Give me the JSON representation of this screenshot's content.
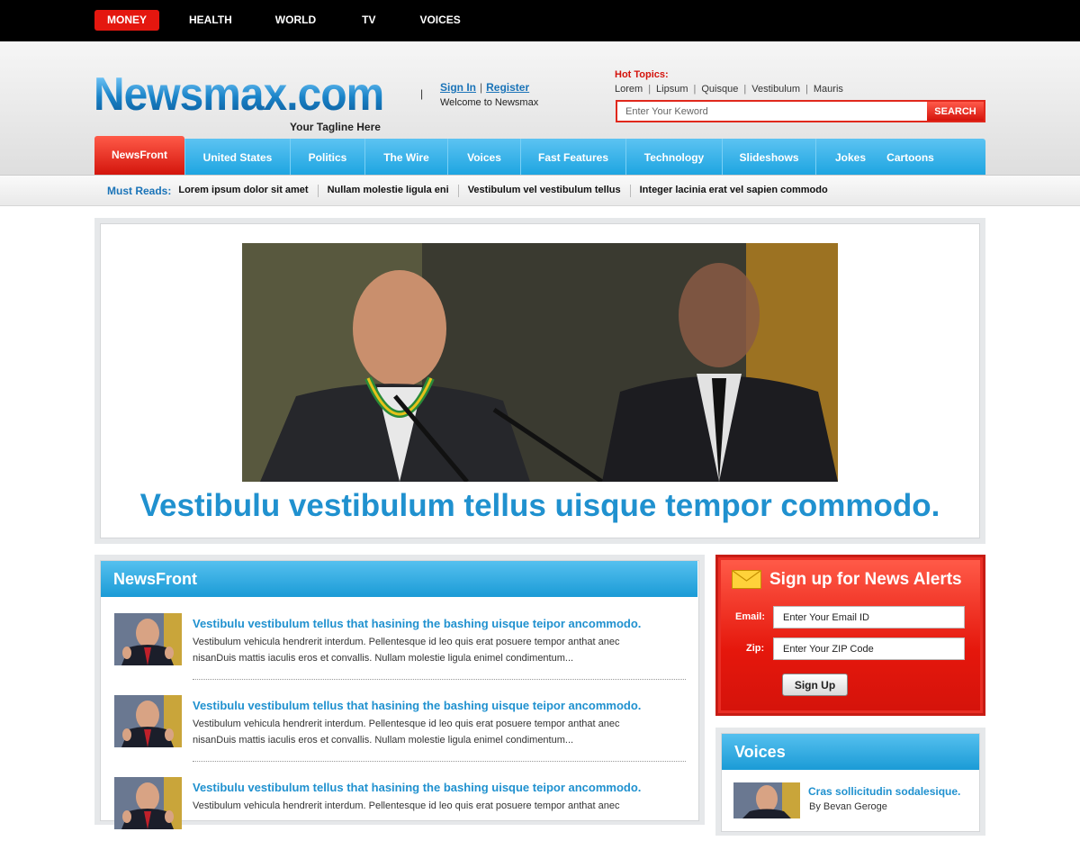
{
  "top_nav": [
    "MONEY",
    "HEALTH",
    "WORLD",
    "TV",
    "VOICES"
  ],
  "header": {
    "logo": "Newsmax.com",
    "tagline": "Your Tagline Here",
    "separator": "|",
    "sign_in": "Sign In",
    "register": "Register",
    "auth_sep": "|",
    "welcome": "Welcome to Newsmax",
    "hot_topics_label": "Hot Topics:",
    "hot_topics": [
      "Lorem",
      "Lipsum",
      "Quisque",
      "Vestibulum",
      "Mauris"
    ],
    "search_placeholder": "Enter Your Keword",
    "search_button": "SEARCH"
  },
  "main_nav": [
    "NewsFront",
    "United States",
    "Politics",
    "The Wire",
    "Voices",
    "Fast Features",
    "Technology",
    "Slideshows",
    "Jokes",
    "Cartoons"
  ],
  "must_reads": {
    "label": "Must Reads:",
    "links": [
      "Lorem ipsum dolor sit amet",
      "Nullam molestie ligula eni",
      "Vestibulum vel vestibulum tellus",
      "Integer lacinia erat vel sapien commodo"
    ]
  },
  "hero": {
    "title": "Vestibulu vestibulum tellus uisque tempor commodo."
  },
  "newsfront": {
    "heading": "NewsFront",
    "articles": [
      {
        "title": "Vestibulu vestibulum tellus that hasining the bashing uisque teipor ancommodo.",
        "line1": "Vestibulum vehicula hendrerit interdum. Pellentesque id leo quis erat posuere tempor anthat  anec",
        "line2": "nisanDuis mattis iaculis eros et convallis. Nullam molestie ligula enimel condimentum..."
      },
      {
        "title": "Vestibulu vestibulum tellus that hasining the bashing uisque teipor ancommodo.",
        "line1": "Vestibulum vehicula hendrerit interdum. Pellentesque id leo quis erat posuere tempor anthat  anec",
        "line2": "nisanDuis mattis iaculis eros et convallis. Nullam molestie ligula enimel condimentum..."
      },
      {
        "title": "Vestibulu vestibulum tellus that hasining the bashing uisque teipor ancommodo.",
        "line1": "Vestibulum vehicula hendrerit interdum. Pellentesque id leo quis erat posuere tempor anthat  anec",
        "line2": ""
      }
    ]
  },
  "signup": {
    "title": "Sign up for News Alerts",
    "email_label": "Email:",
    "email_placeholder": "Enter Your Email ID",
    "zip_label": "Zip:",
    "zip_placeholder": "Enter Your ZIP Code",
    "button": "Sign Up"
  },
  "voices": {
    "heading": "Voices",
    "item_title": "Cras sollicitudin sodalesique.",
    "item_byline": "By Bevan Geroge"
  },
  "colors": {
    "accent_red": "#e4170f",
    "accent_blue": "#1ea5e1",
    "link_blue": "#2091cf"
  }
}
